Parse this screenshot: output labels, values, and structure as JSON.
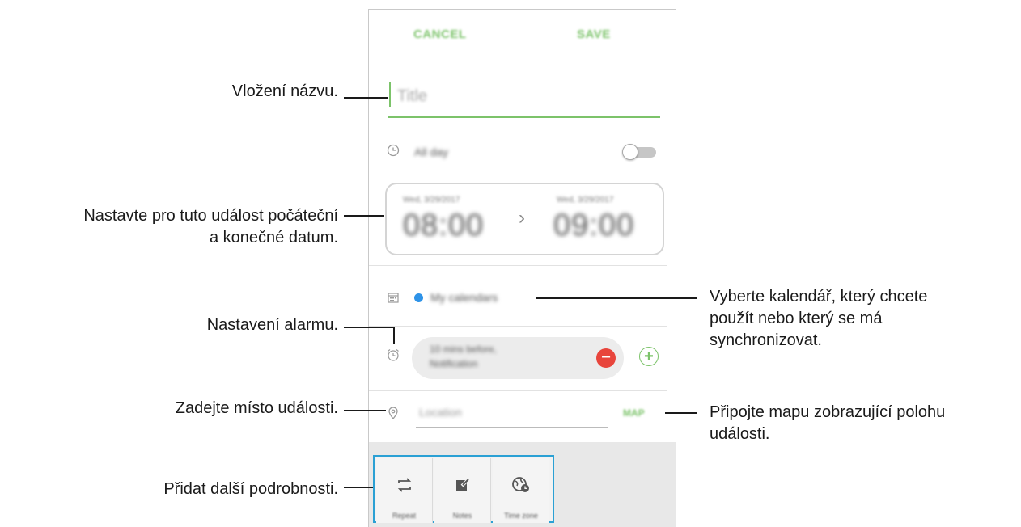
{
  "screen": {
    "topbar": {
      "cancel_label": "CANCEL",
      "save_label": "SAVE"
    },
    "title_field": {
      "placeholder": "Title"
    },
    "all_day": {
      "label": "All day",
      "toggle_on": false
    },
    "dates": {
      "start_date": "Wed, 3/29/2017",
      "start_time": "08:00",
      "end_date": "Wed, 3/29/2017",
      "end_time": "09:00",
      "arrow": "›"
    },
    "calendar": {
      "label": "My calendars",
      "color": "#2e93e8"
    },
    "alarm": {
      "value_line1": "10 mins before,",
      "value_line2": "Notification",
      "remove": "−",
      "add": "+"
    },
    "location": {
      "placeholder": "Location",
      "map_label": "MAP"
    },
    "details": [
      {
        "label": "Repeat",
        "icon": "repeat-icon"
      },
      {
        "label": "Notes",
        "icon": "notes-icon"
      },
      {
        "label": "Time zone",
        "icon": "time-zone-icon"
      }
    ]
  },
  "callouts": {
    "title": "Vložení názvu.",
    "dates_line1": "Nastavte pro tuto událost počáteční",
    "dates_line2": "a konečné datum.",
    "alarm": "Nastavení alarmu.",
    "location": "Zadejte místo události.",
    "details": "Přidat další podrobnosti.",
    "calendar_line1": "Vyberte kalendář, který chcete",
    "calendar_line2": "použít nebo který se má",
    "calendar_line3": "synchronizovat.",
    "map_line1": "Připojte mapu zobrazující polohu",
    "map_line2": "události."
  },
  "colors": {
    "accent_green": "#7cc36a",
    "callout_box": "#2aa0d4",
    "alarm_remove": "#e8453c"
  }
}
